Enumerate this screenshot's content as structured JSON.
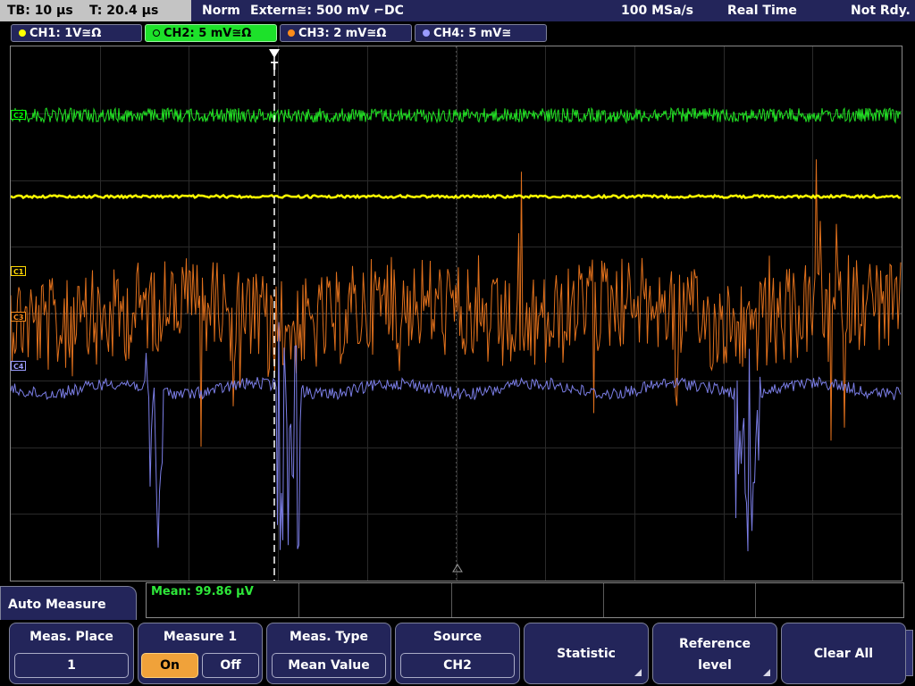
{
  "status": {
    "timebase": "TB: 10 µs",
    "trigger_time": "T: 20.4 µs",
    "mode": "Norm",
    "trigger_source": "Extern≅: 500 mV ⌐DC",
    "sample_rate": "100 MSa/s",
    "acq_mode": "Real Time",
    "state": "Not Rdy."
  },
  "channels": [
    {
      "label": "CH1: 1V≅Ω",
      "color": "#ffff00",
      "active": false
    },
    {
      "label": "CH2: 5 mV≅Ω",
      "color": "#00ff00",
      "active": true
    },
    {
      "label": "CH3: 2 mV≅Ω",
      "color": "#ff8c1a",
      "active": false
    },
    {
      "label": "CH4: 5 mV≅",
      "color": "#9a9cff",
      "active": false
    }
  ],
  "screen_markers": {
    "c1": "C1",
    "c2": "C2",
    "c3": "C3",
    "c4": "C4",
    "trigger": "T"
  },
  "measurement": {
    "result": "Mean: 99.86 µV",
    "color": "#2ee83a"
  },
  "menu": {
    "title": "Auto Measure",
    "keys": {
      "meas_place": {
        "label": "Meas. Place",
        "value": "1"
      },
      "measure_1": {
        "label": "Measure 1",
        "on": "On",
        "off": "Off"
      },
      "meas_type": {
        "label": "Meas. Type",
        "value": "Mean Value"
      },
      "source": {
        "label": "Source",
        "value": "CH2"
      },
      "statistic": {
        "label": "Statistic"
      },
      "reference_level": {
        "label_line1": "Reference",
        "label_line2": "level"
      },
      "clear_all": {
        "label": "Clear All"
      }
    }
  }
}
